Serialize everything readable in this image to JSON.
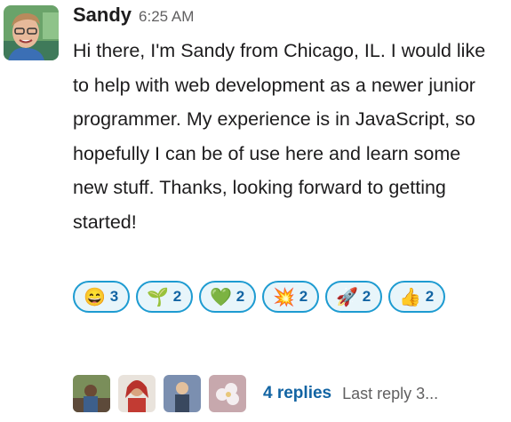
{
  "message": {
    "author": "Sandy",
    "time": "6:25 AM",
    "text": "Hi there, I'm Sandy from Chicago, IL. I would like to help with web development as a newer junior programmer. My experience is in JavaScript, so hopefully I can be of use here and learn some new stuff. Thanks, looking forward to getting started!"
  },
  "reactions": [
    {
      "icon": "grinning-face-icon",
      "glyph": "😄",
      "count": "3"
    },
    {
      "icon": "seedling-icon",
      "glyph": "🌱",
      "count": "2"
    },
    {
      "icon": "green-heart-icon",
      "glyph": "💚",
      "count": "2"
    },
    {
      "icon": "collision-icon",
      "glyph": "💥",
      "count": "2"
    },
    {
      "icon": "rocket-icon",
      "glyph": "🚀",
      "count": "2"
    },
    {
      "icon": "thumbs-up-icon",
      "glyph": "👍",
      "count": "2"
    }
  ],
  "thread": {
    "replies": "4 replies",
    "last_reply": "Last reply 3..."
  },
  "colors": {
    "reaction_border": "#1d9bd1",
    "reaction_bg": "#e8f5fa",
    "link": "#1264a3"
  }
}
